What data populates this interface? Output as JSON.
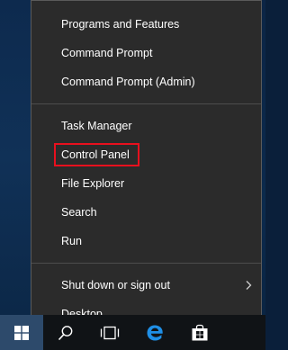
{
  "menu": {
    "groups": [
      {
        "items": [
          {
            "label": "Programs and Features"
          },
          {
            "label": "Command Prompt"
          },
          {
            "label": "Command Prompt (Admin)"
          }
        ]
      },
      {
        "items": [
          {
            "label": "Task Manager"
          },
          {
            "label": "Control Panel",
            "highlighted": true
          },
          {
            "label": "File Explorer"
          },
          {
            "label": "Search"
          },
          {
            "label": "Run"
          }
        ]
      },
      {
        "items": [
          {
            "label": "Shut down or sign out",
            "has_submenu": true
          },
          {
            "label": "Desktop"
          }
        ]
      }
    ]
  },
  "taskbar": {
    "icons": [
      "windows-start-icon",
      "search-icon",
      "task-view-icon",
      "edge-browser-icon",
      "store-icon"
    ],
    "accent_color": "#2d4a6b"
  },
  "colors": {
    "menu_bg": "#2b2b2b",
    "highlight": "#e8101e",
    "edge_blue": "#1f8fe6"
  }
}
